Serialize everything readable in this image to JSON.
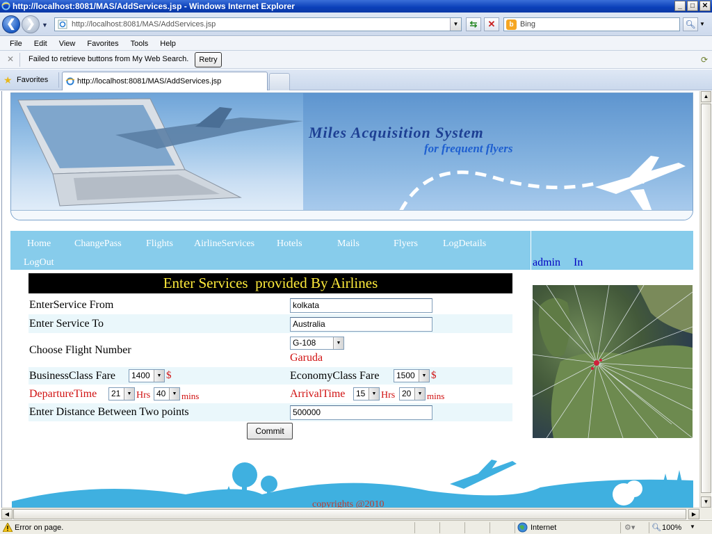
{
  "window": {
    "title": "http://localhost:8081/MAS/AddServices.jsp - Windows Internet Explorer",
    "minimize": "_",
    "maximize": "□",
    "close": "✕"
  },
  "address": {
    "url": "http://localhost:8081/MAS/AddServices.jsp",
    "search_placeholder": "Bing"
  },
  "menu": [
    "File",
    "Edit",
    "View",
    "Favorites",
    "Tools",
    "Help"
  ],
  "infobar": {
    "message": "Failed to retrieve buttons from My Web Search.",
    "retry": "Retry"
  },
  "favorites_label": "Favorites",
  "tab": {
    "label": "http://localhost:8081/MAS/AddServices.jsp"
  },
  "banner": {
    "title": "Miles Acquisition System",
    "subtitle": "for frequent flyers"
  },
  "nav": {
    "items": [
      "Home",
      "ChangePass",
      "Flights",
      "AirlineServices",
      "Hotels",
      "Mails",
      "Flyers",
      "LogDetails",
      "LogOut"
    ],
    "user": "admin",
    "status": "In"
  },
  "form": {
    "heading": "Enter Services  provided By Airlines",
    "service_from_label": "EnterService From",
    "service_from_value": "kolkata",
    "service_to_label": "Enter Service To",
    "service_to_value": "Australia",
    "flight_label": "Choose Flight Number",
    "flight_value": "G-108",
    "airline_name": "Garuda",
    "business_label": "BusinessClass Fare",
    "business_value": "1400",
    "economy_label": "EconomyClass Fare",
    "economy_value": "1500",
    "currency": "$",
    "departure_label": "DepartureTime",
    "departure_hrs": "21",
    "departure_mins": "40",
    "arrival_label": "ArrivalTime",
    "arrival_hrs": "15",
    "arrival_mins": "20",
    "hrs_unit": "Hrs",
    "mins_unit": "mins",
    "distance_label": "Enter Distance Between Two points",
    "distance_value": "500000",
    "commit": "Commit"
  },
  "footer": {
    "copyright": "copyrights @2010"
  },
  "status": {
    "text": "Error on page.",
    "zone": "Internet",
    "zoom": "100%"
  },
  "colors": {
    "nav_bg": "#87cceb",
    "heading_bg": "#000000",
    "heading_text": "#ffeb3b",
    "label_red": "#d01010",
    "row_alt": "#eaf7fb",
    "footer_blue": "#3fb0e0"
  }
}
